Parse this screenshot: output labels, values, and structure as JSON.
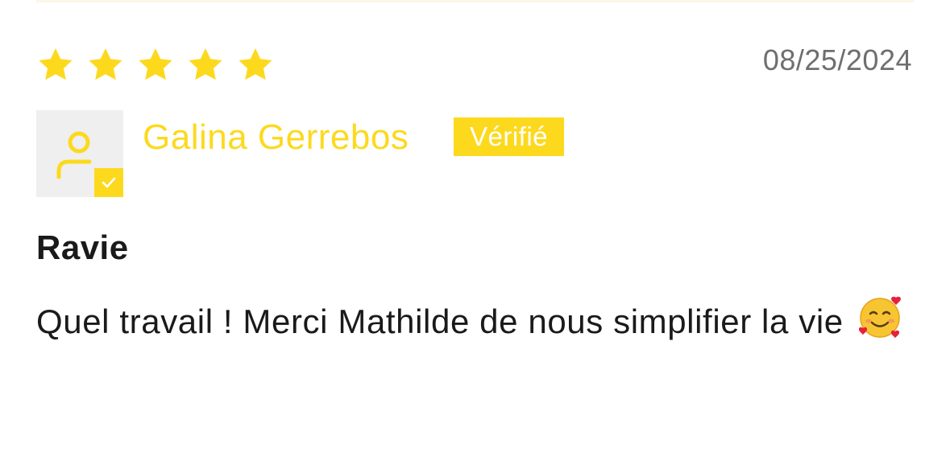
{
  "colors": {
    "accent": "#fdd91e",
    "text": "#1a1a1a",
    "muted": "#6f6f6f",
    "avatar_bg": "#efefef"
  },
  "review": {
    "rating": 5,
    "rating_max": 5,
    "date": "08/25/2024",
    "reviewer": {
      "name": "Galina Gerrebos",
      "verified_label": "Vérifié",
      "avatar_icon": "user-icon",
      "verified_icon": "check-icon"
    },
    "title": "Ravie",
    "body_text": "Quel travail ! Merci Mathilde de nous simplifier la vie",
    "body_emoji": "smiling-face-with-hearts-icon"
  }
}
